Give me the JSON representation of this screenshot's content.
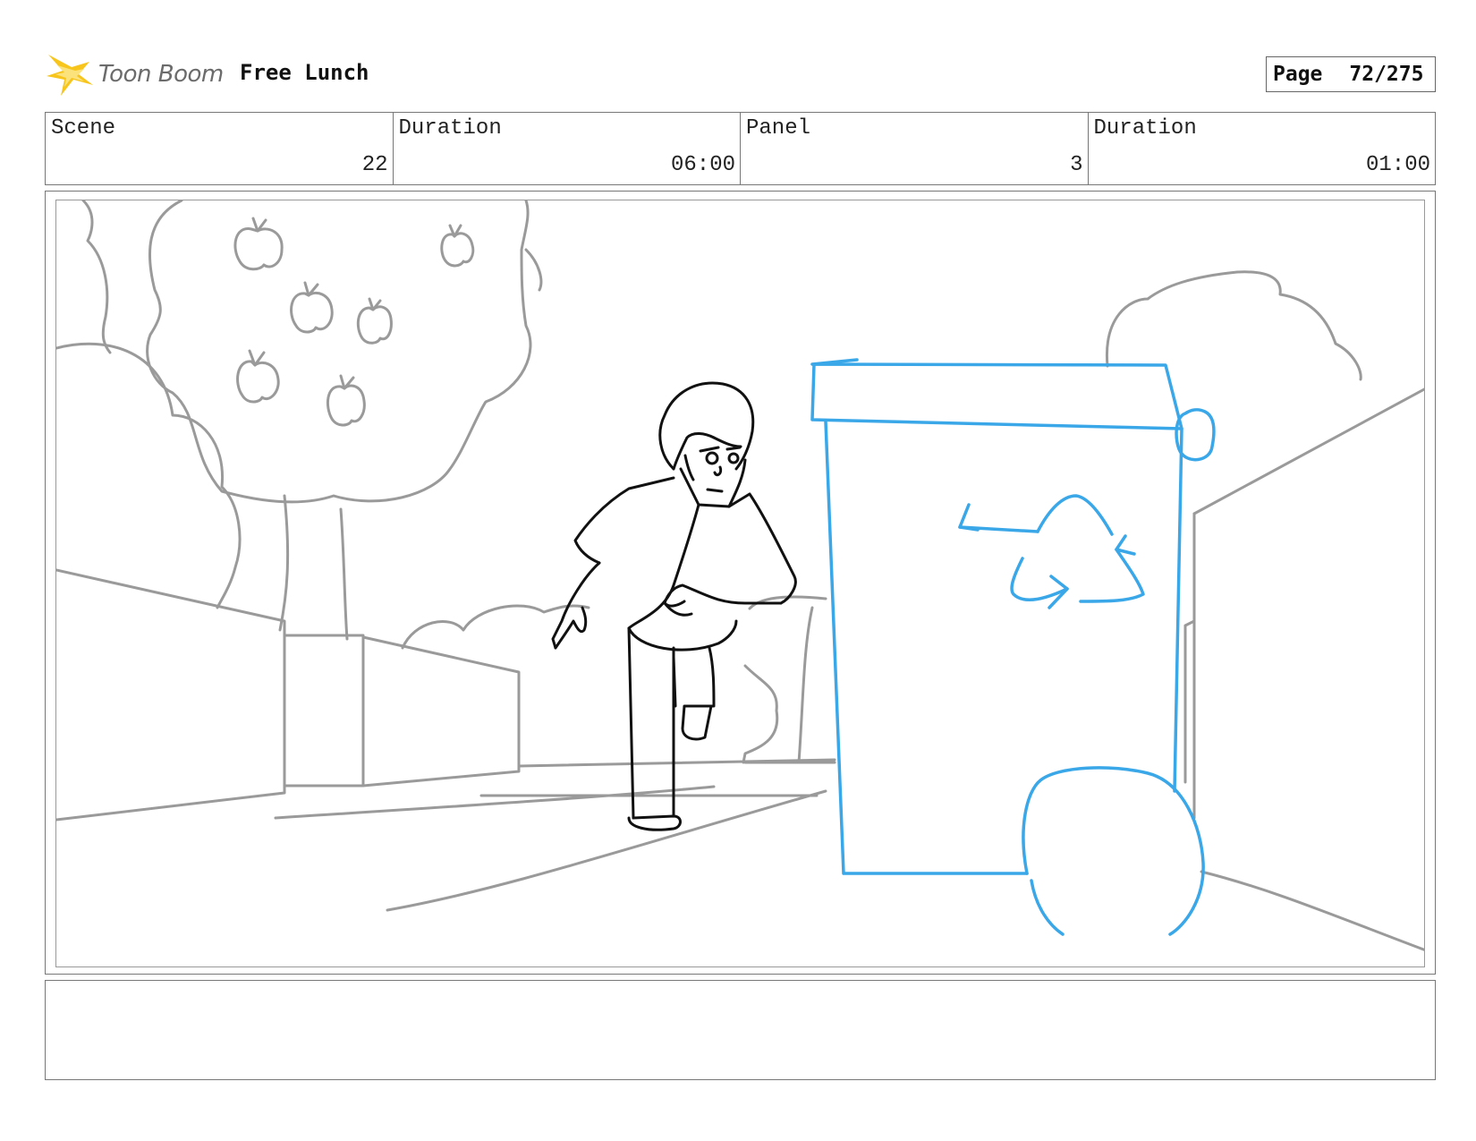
{
  "header": {
    "logo_text": "Toon Boom",
    "project_title": "Free Lunch",
    "page_label": "Page",
    "page_value": "72/275"
  },
  "info": [
    {
      "label": "Scene",
      "value": "22"
    },
    {
      "label": "Duration",
      "value": "06:00"
    },
    {
      "label": "Panel",
      "value": "3"
    },
    {
      "label": "Duration",
      "value": "01:00"
    }
  ],
  "notes": {
    "text": ""
  },
  "colors": {
    "sketch_gray": "#9a9a9a",
    "sketch_black": "#111111",
    "sketch_blue": "#3aa7e8",
    "logo_yellow": "#f7c51c"
  },
  "icons": {
    "logo": "toon-boom-starburst-icon",
    "recycle": "recycle-symbol-icon"
  }
}
